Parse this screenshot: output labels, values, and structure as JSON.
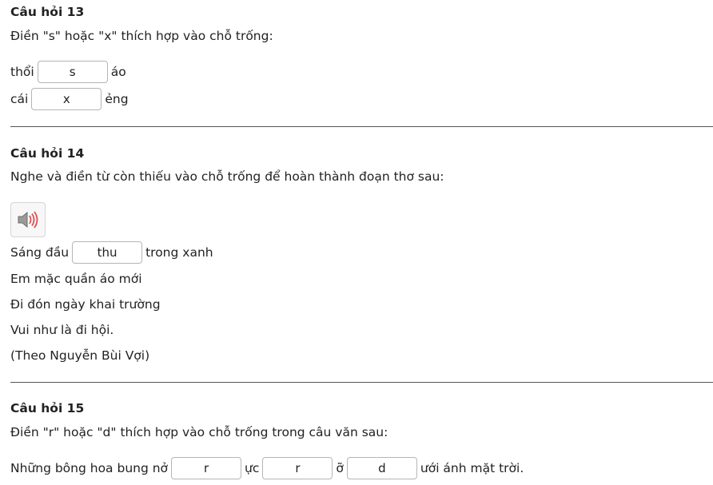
{
  "q13": {
    "title": "Câu hỏi 13",
    "prompt": "Điền \"s\" hoặc \"x\" thích hợp vào chỗ trống:",
    "lines": [
      {
        "before": "thổi",
        "answer": "s",
        "after": "áo"
      },
      {
        "before": "cái",
        "answer": "x",
        "after": "ẻng"
      }
    ]
  },
  "q14": {
    "title": "Câu hỏi 14",
    "prompt": "Nghe và điền từ còn thiếu vào chỗ trống để hoàn thành đoạn thơ sau:",
    "audio_icon": "speaker-icon",
    "line1": {
      "before": "Sáng đầu",
      "answer": "thu",
      "after": "trong xanh"
    },
    "poem": [
      "Em mặc quần áo mới",
      "Đi đón ngày khai trường",
      "Vui như là đi hội.",
      "(Theo Nguyễn Bùi Vợi)"
    ]
  },
  "q15": {
    "title": "Câu hỏi 15",
    "prompt": "Điền \"r\" hoặc \"d\" thích hợp vào chỗ trống trong câu văn sau:",
    "seg1": "Những bông hoa bung nở",
    "ans1": "r",
    "seg2": "ực",
    "ans2": "r",
    "seg3": "ỡ",
    "ans3": "d",
    "seg4": "ưới ánh mặt trời."
  }
}
